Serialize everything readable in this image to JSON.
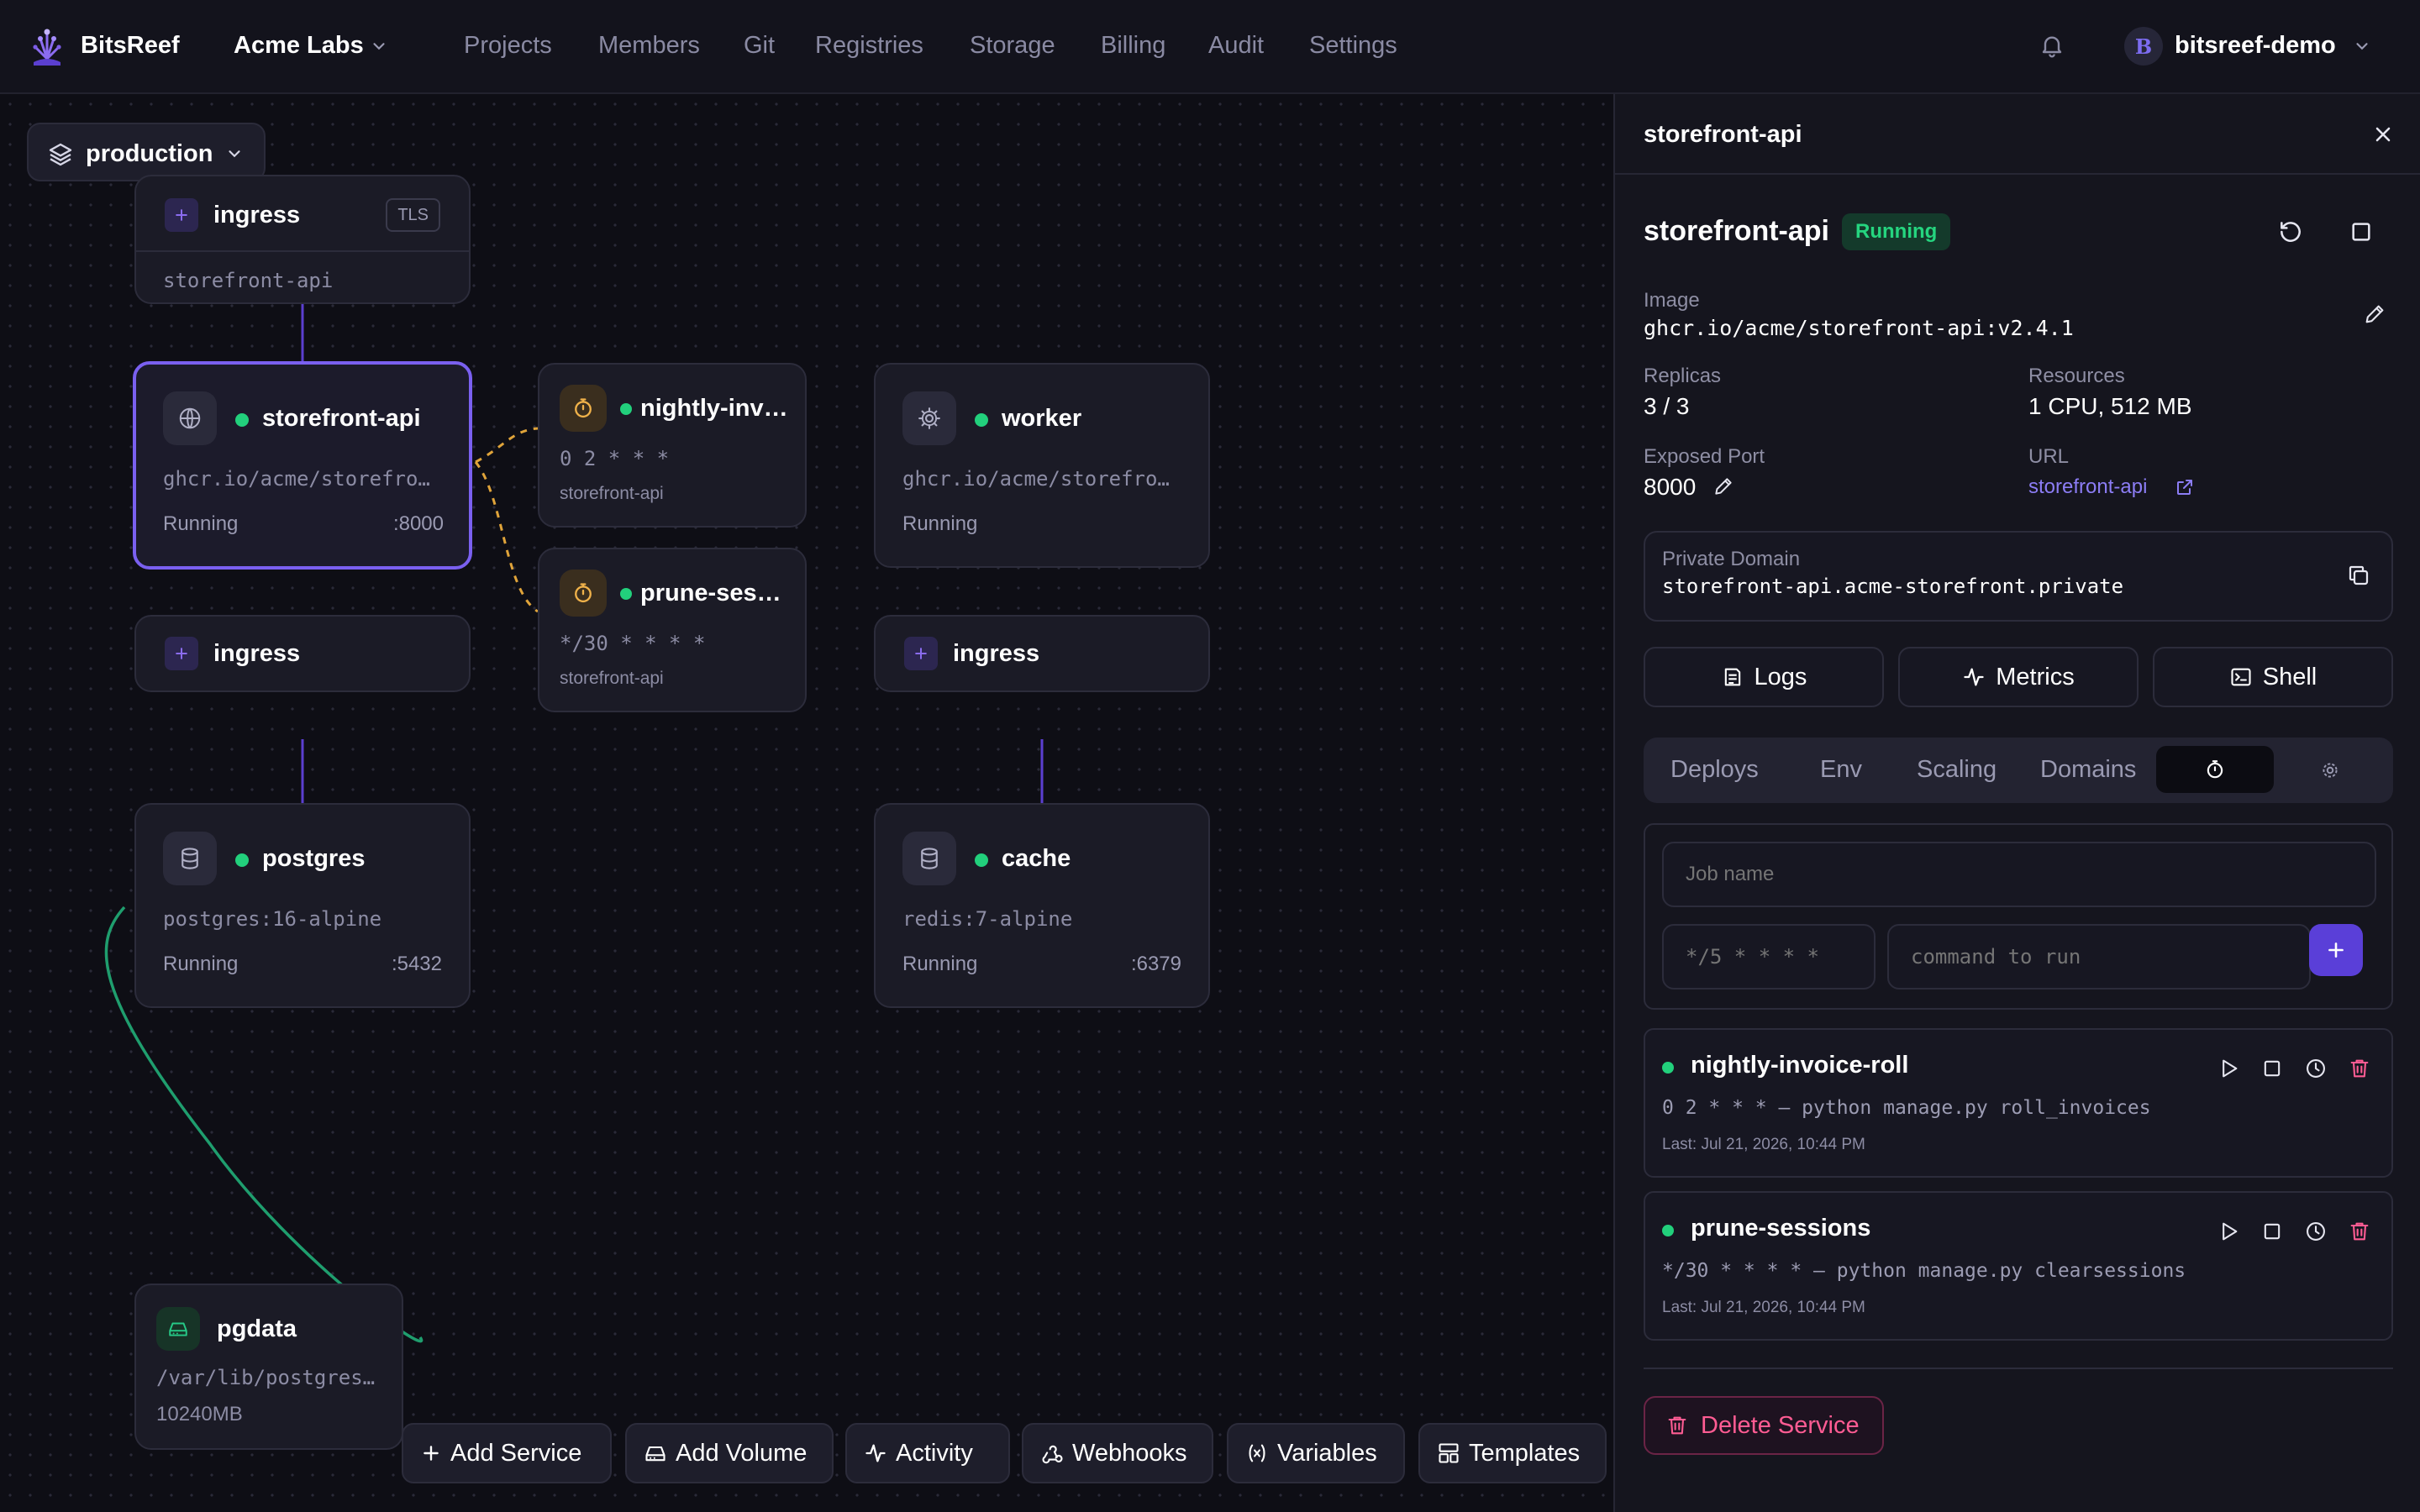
{
  "topbar": {
    "brand": "BitsReef",
    "org": "Acme Labs",
    "nav": [
      "Projects",
      "Members",
      "Git",
      "Registries",
      "Storage",
      "Billing",
      "Audit",
      "Settings"
    ],
    "user_initial": "B",
    "username": "bitsreef-demo"
  },
  "canvas": {
    "environment": "production",
    "cards": {
      "ingress_top": {
        "name": "ingress",
        "tag": "TLS",
        "target": "storefront-api"
      },
      "storefront": {
        "name": "storefront-api",
        "image": "ghcr.io/acme/storefro…",
        "status": "Running",
        "port": ":8000"
      },
      "nightly": {
        "name": "nightly-inv…",
        "schedule": "0 2 * * *",
        "service": "storefront-api"
      },
      "prune": {
        "name": "prune-ses…",
        "schedule": "*/30 * * * *",
        "service": "storefront-api"
      },
      "worker": {
        "name": "worker",
        "image": "ghcr.io/acme/storefro…",
        "status": "Running"
      },
      "ingress_left": {
        "name": "ingress"
      },
      "ingress_right": {
        "name": "ingress"
      },
      "postgres": {
        "name": "postgres",
        "image": "postgres:16-alpine",
        "status": "Running",
        "port": ":5432"
      },
      "cache": {
        "name": "cache",
        "image": "redis:7-alpine",
        "status": "Running",
        "port": ":6379"
      },
      "pgdata": {
        "name": "pgdata",
        "path": "/var/lib/postgres…",
        "size": "10240MB"
      }
    },
    "toolbar": [
      "Add Service",
      "Add Volume",
      "Activity",
      "Webhooks",
      "Variables",
      "Templates"
    ]
  },
  "panel": {
    "header_title": "storefront-api",
    "service_name": "storefront-api",
    "status": "Running",
    "image_label": "Image",
    "image": "ghcr.io/acme/storefront-api:v2.4.1",
    "replicas_label": "Replicas",
    "replicas": "3 / 3",
    "resources_label": "Resources",
    "resources": "1 CPU, 512 MB",
    "port_label": "Exposed Port",
    "port": "8000",
    "url_label": "URL",
    "url": "storefront-api",
    "private_domain_label": "Private Domain",
    "private_domain": "storefront-api.acme-storefront.private",
    "actions": [
      "Logs",
      "Metrics",
      "Shell"
    ],
    "tabs": [
      "Deploys",
      "Env",
      "Scaling",
      "Domains"
    ],
    "active_tab_icon": "stopwatch-icon",
    "job_form": {
      "name_placeholder": "Job name",
      "schedule_placeholder": "*/5 * * * *",
      "command_placeholder": "command to run"
    },
    "jobs": [
      {
        "name": "nightly-invoice-roll",
        "schedule": "0 2 * * *",
        "command": "python manage.py roll_invoices",
        "last": "Last: Jul 21, 2026, 10:44 PM"
      },
      {
        "name": "prune-sessions",
        "schedule": "*/30 * * * *",
        "command": "python manage.py clearsessions",
        "last": "Last: Jul 21, 2026, 10:44 PM"
      }
    ],
    "delete_label": "Delete Service"
  },
  "colors": {
    "accent": "#7a60f0",
    "running": "#22d07c",
    "danger": "#ff5c93",
    "cron": "#e0a43a",
    "volume_link": "#1f9e6e"
  }
}
